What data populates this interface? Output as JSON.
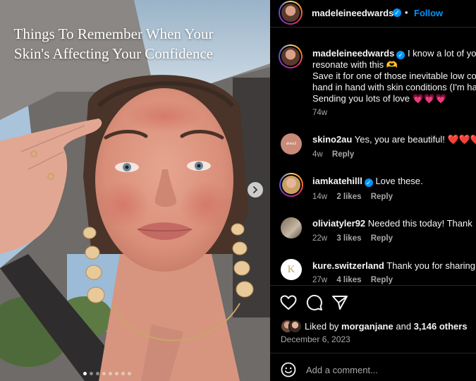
{
  "post_image": {
    "overlay_title": "Things To Remember When Your Skin's Affecting Your Confidence",
    "carousel_total": 8,
    "carousel_active": 1
  },
  "header": {
    "username": "madeleineedwards",
    "separator": "•",
    "follow_label": "Follow"
  },
  "caption": {
    "username": "madeleineedwards",
    "lines": [
      "I know a lot of yo",
      "resonate with this 🫶",
      "Save it for one of those inevitable low co",
      "hand in hand with skin conditions (I'm ha",
      "Sending you lots of love 💗💗💗"
    ],
    "age": "74w"
  },
  "comments": [
    {
      "username": "skino2au",
      "text": "Yes, you are beautiful! ❤️❤️❤️",
      "age": "4w",
      "likes": "",
      "reply": "Reply",
      "verified": false
    },
    {
      "username": "iamkatehilll",
      "text": "Love these.",
      "age": "14w",
      "likes": "2 likes",
      "reply": "Reply",
      "verified": true
    },
    {
      "username": "oliviatyler92",
      "text": "Needed this today! Thank",
      "age": "22w",
      "likes": "3 likes",
      "reply": "Reply",
      "verified": false
    },
    {
      "username": "kure.switzerland",
      "text": "Thank you for sharing",
      "age": "27w",
      "likes": "4 likes",
      "reply": "Reply",
      "verified": false
    }
  ],
  "engagement": {
    "liked_prefix": "Liked by",
    "liked_user": "morganjane",
    "liked_and": "and",
    "liked_others": "3,146 others",
    "date": "December 6, 2023"
  },
  "comment_box": {
    "placeholder": "Add a comment..."
  },
  "icons": {
    "like": "heart-icon",
    "comment": "comment-icon",
    "share": "share-icon",
    "emoji": "emoji-icon",
    "next": "chevron-right-icon",
    "verified": "verified-badge-icon"
  },
  "colors": {
    "link_blue": "#0095f6",
    "muted_text": "#a8a8a8",
    "panel_bg": "#000000"
  }
}
